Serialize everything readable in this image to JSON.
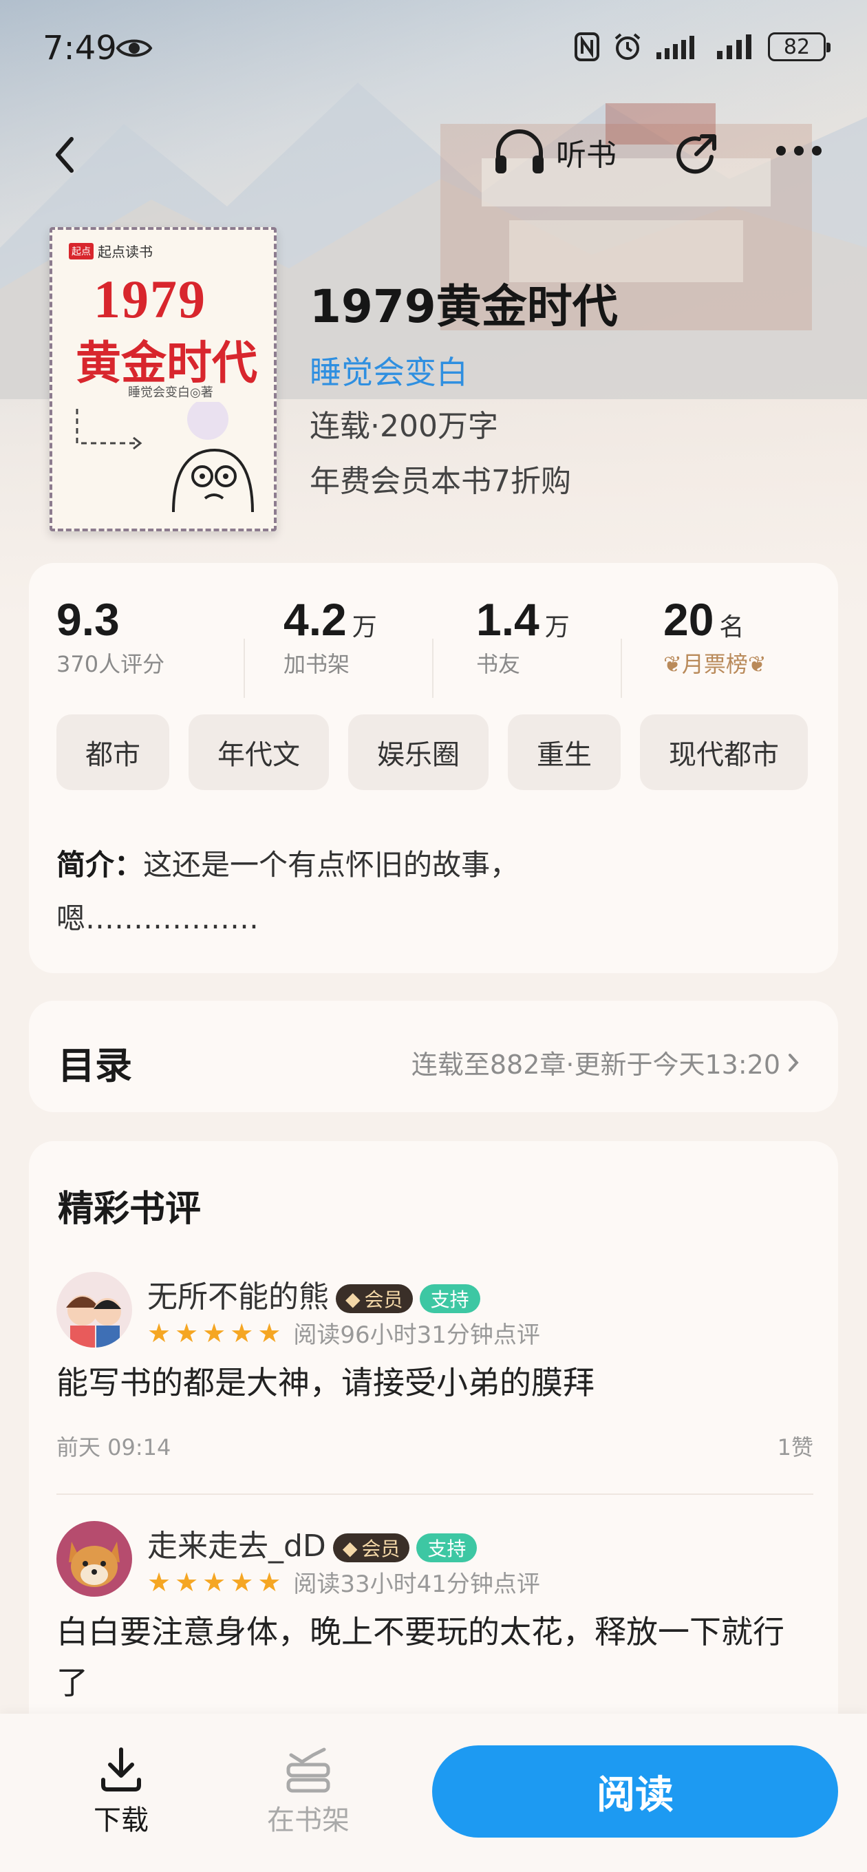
{
  "status_bar": {
    "time": "7:49",
    "battery": "82"
  },
  "nav": {
    "listen_label": "听书"
  },
  "book": {
    "title": "1979黄金时代",
    "author": "睡觉会变白",
    "meta": "连载·200万字",
    "promo": "年费会员本书7折购",
    "cover": {
      "brand": "起点读书",
      "title_line1": "1979",
      "title_line2": "黄金时代",
      "author_line": "睡觉会变白◎著"
    }
  },
  "stats": [
    {
      "num": "9.3",
      "unit": "",
      "label": "370人评分"
    },
    {
      "num": "4.2",
      "unit": "万",
      "label": "加书架"
    },
    {
      "num": "1.4",
      "unit": "万",
      "label": "书友"
    },
    {
      "num": "20",
      "unit": "名",
      "label": "月票榜"
    }
  ],
  "tags": [
    "都市",
    "年代文",
    "娱乐圈",
    "重生",
    "现代都市"
  ],
  "intro": {
    "label": "简介：",
    "text": "这还是一个有点怀旧的故事，",
    "text2": "嗯………………"
  },
  "toc": {
    "title": "目录",
    "info": "连载至882章·更新于今天13:20"
  },
  "reviews": {
    "title": "精彩书评",
    "items": [
      {
        "user": "无所不能的熊",
        "vip": "会员",
        "support": "支持",
        "stars": 5,
        "read_time": "阅读96小时31分钟点评",
        "text": "能写书的都是大神，请接受小弟的膜拜",
        "date": "前天 09:14",
        "likes": "1赞"
      },
      {
        "user": "走来走去_dD",
        "vip": "会员",
        "support": "支持",
        "stars": 5,
        "read_time": "阅读33小时41分钟点评",
        "text": "白白要注意身体，晚上不要玩的太花，释放一下就行了"
      }
    ]
  },
  "bottom": {
    "download": "下载",
    "on_shelf": "在书架",
    "read": "阅读"
  },
  "colors": {
    "accent_blue": "#1d9af2",
    "author_blue": "#2f8fe0",
    "star": "#f5a623",
    "support_badge": "#3dc7a3"
  }
}
